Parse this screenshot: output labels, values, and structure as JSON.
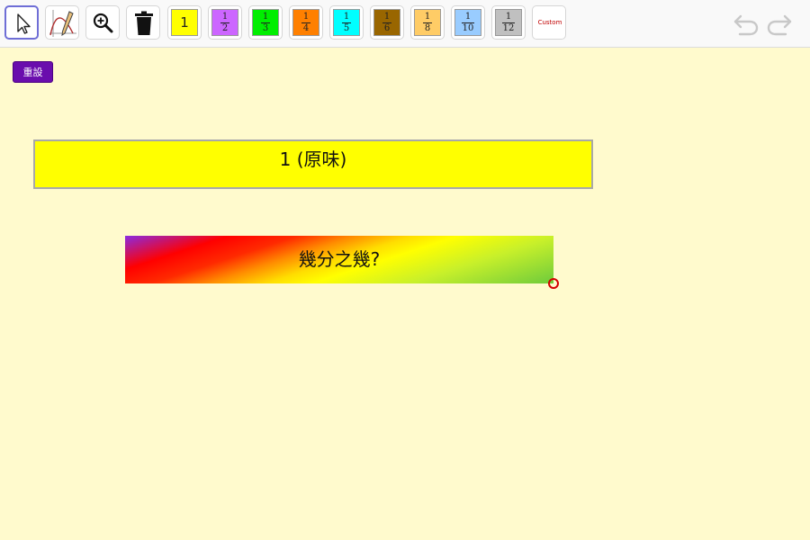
{
  "toolbar": {
    "tools": [
      {
        "id": "move",
        "icon": "cursor-arrow-icon",
        "selected": true
      },
      {
        "id": "pen",
        "icon": "pen-graph-icon"
      },
      {
        "id": "zoom",
        "icon": "zoom-in-icon"
      },
      {
        "id": "delete",
        "icon": "trash-icon"
      }
    ],
    "fraction_buttons": [
      {
        "label": "1",
        "numerator": "",
        "denominator": "",
        "color": "#ffff00"
      },
      {
        "label": "",
        "numerator": "1",
        "denominator": "2",
        "color": "#cc66ff"
      },
      {
        "label": "",
        "numerator": "1",
        "denominator": "3",
        "color": "#00ee00"
      },
      {
        "label": "",
        "numerator": "1",
        "denominator": "4",
        "color": "#ff8000"
      },
      {
        "label": "",
        "numerator": "1",
        "denominator": "5",
        "color": "#00ffff"
      },
      {
        "label": "",
        "numerator": "1",
        "denominator": "6",
        "color": "#996600"
      },
      {
        "label": "",
        "numerator": "1",
        "denominator": "8",
        "color": "#ffcc66"
      },
      {
        "label": "",
        "numerator": "1",
        "denominator": "10",
        "color": "#99ccff"
      },
      {
        "label": "",
        "numerator": "1",
        "denominator": "12",
        "color": "#c0c0c0"
      }
    ],
    "custom_label": "Custom",
    "undo_icon": "undo-icon",
    "redo_icon": "redo-icon"
  },
  "reset_button": {
    "label": "重設",
    "color": "#6a0dad"
  },
  "whole_bar": {
    "label": "1 (原味)",
    "color": "#ffff00"
  },
  "mystery_bar": {
    "label": "幾分之幾?"
  }
}
